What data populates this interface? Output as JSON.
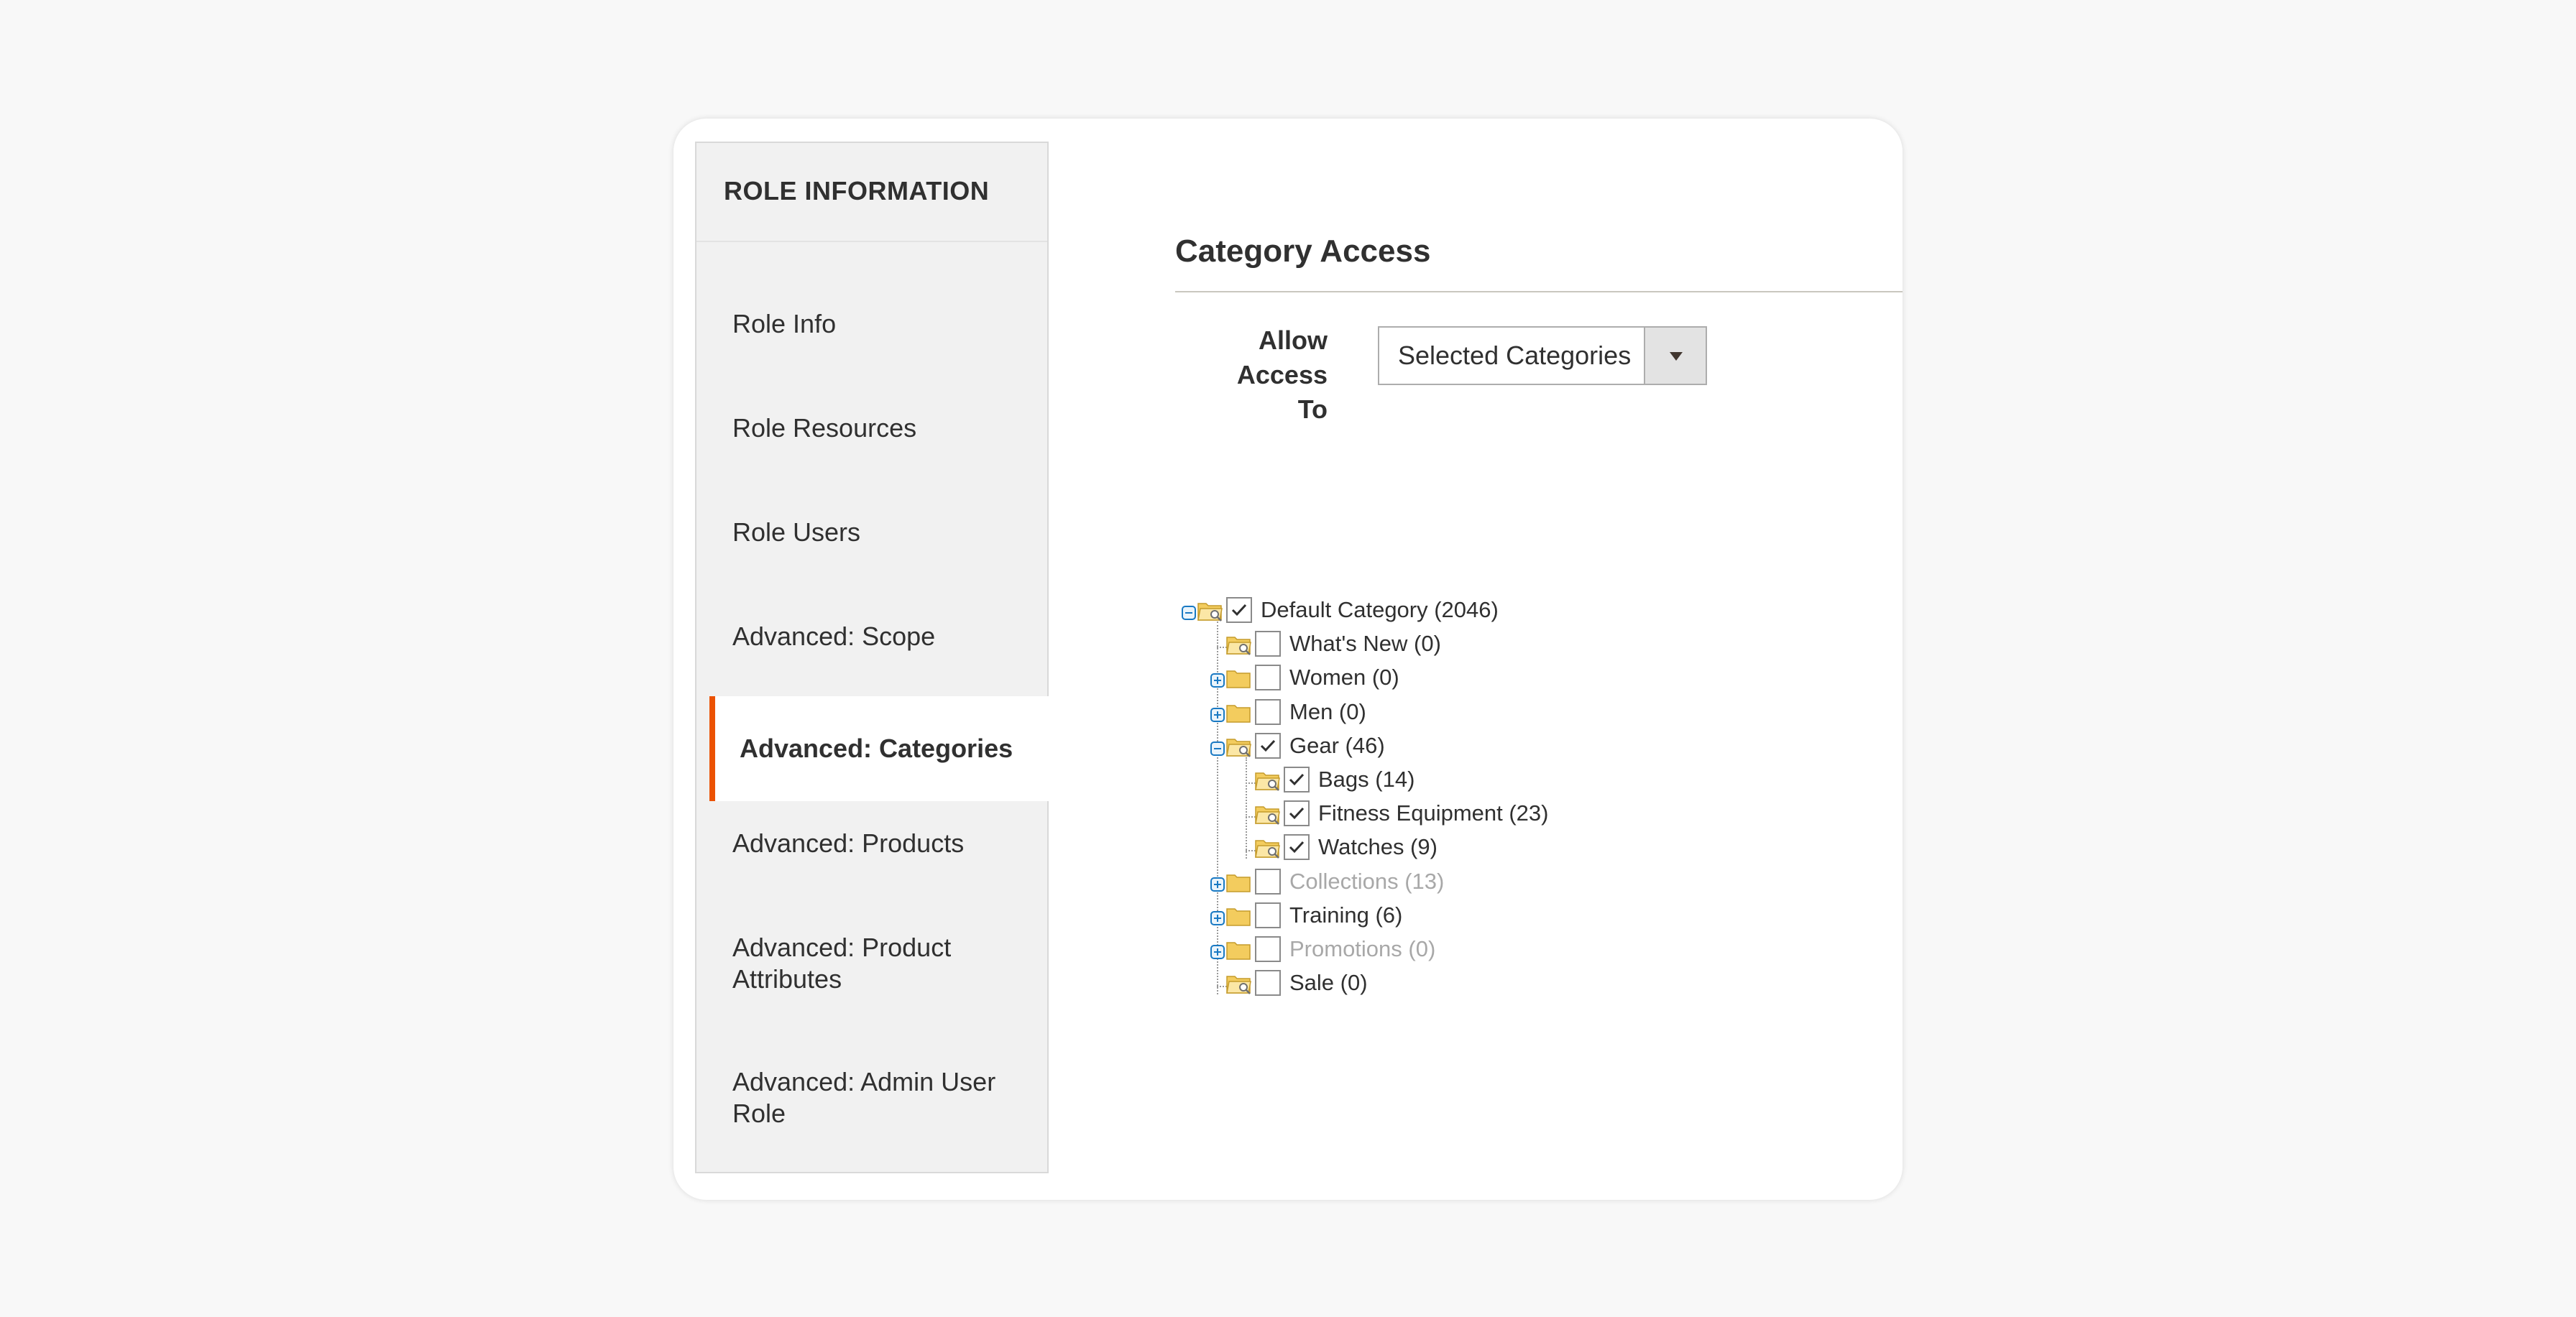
{
  "sidebar": {
    "title": "ROLE INFORMATION",
    "items": [
      {
        "label": "Role Info"
      },
      {
        "label": "Role Resources"
      },
      {
        "label": "Role Users"
      },
      {
        "label": "Advanced: Scope"
      },
      {
        "label": "Advanced: Categories",
        "active": true
      },
      {
        "label": "Advanced: Products"
      },
      {
        "label": "Advanced: Product Attributes"
      },
      {
        "label": "Advanced: Admin User Role"
      }
    ]
  },
  "main": {
    "section_title": "Category Access",
    "allow_access_label": "Allow Access To",
    "allow_access_value": "Selected Categories"
  },
  "colors": {
    "accent": "#eb5202",
    "tree_toggle": "#1979c3",
    "folder": "#f3cc5e"
  },
  "tree": [
    {
      "label": "Default Category (2046)",
      "checked": true,
      "expanded": true,
      "disabled": false
    },
    {
      "label": "What's New (0)",
      "checked": false,
      "expanded": false,
      "disabled": false
    },
    {
      "label": "Women (0)",
      "checked": false,
      "expanded": false,
      "disabled": false
    },
    {
      "label": "Men (0)",
      "checked": false,
      "expanded": false,
      "disabled": false
    },
    {
      "label": "Gear (46)",
      "checked": true,
      "expanded": true,
      "disabled": false
    },
    {
      "label": "Bags (14)",
      "checked": true,
      "expanded": false,
      "disabled": false
    },
    {
      "label": "Fitness Equipment (23)",
      "checked": true,
      "expanded": false,
      "disabled": false
    },
    {
      "label": "Watches (9)",
      "checked": true,
      "expanded": false,
      "disabled": false
    },
    {
      "label": "Collections (13)",
      "checked": false,
      "expanded": false,
      "disabled": true
    },
    {
      "label": "Training (6)",
      "checked": false,
      "expanded": false,
      "disabled": false
    },
    {
      "label": "Promotions (0)",
      "checked": false,
      "expanded": false,
      "disabled": true
    },
    {
      "label": "Sale (0)",
      "checked": false,
      "expanded": false,
      "disabled": false
    }
  ]
}
